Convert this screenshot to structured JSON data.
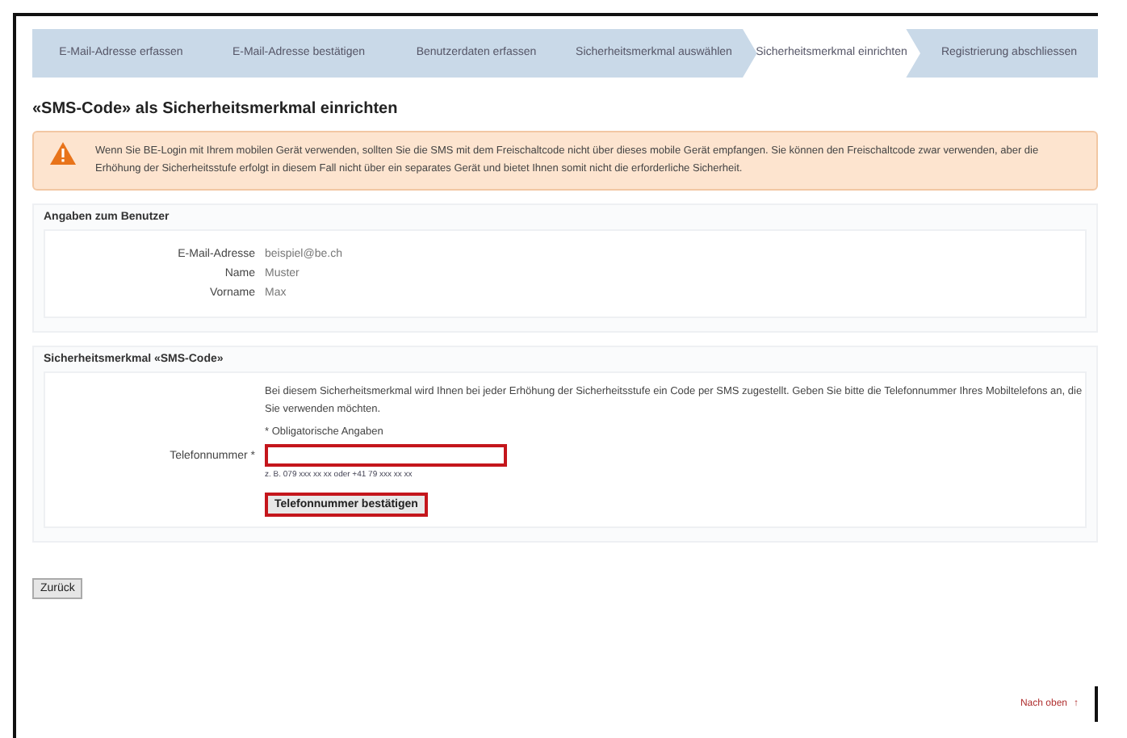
{
  "steps": [
    {
      "label": "E-Mail-Adresse erfassen",
      "selected": false
    },
    {
      "label": "E-Mail-Adresse bestätigen",
      "selected": false
    },
    {
      "label": "Benutzerdaten erfassen",
      "selected": false
    },
    {
      "label": "Sicherheitsmerkmal auswählen",
      "selected": false
    },
    {
      "label": "Sicherheitsmerkmal einrichten",
      "selected": true
    },
    {
      "label": "Registrierung abschliessen",
      "selected": false
    }
  ],
  "title": "«SMS-Code» als Sicherheitsmerkmal einrichten",
  "warning": "Wenn Sie BE-Login mit Ihrem mobilen Gerät verwenden, sollten Sie die SMS mit dem Freischaltcode nicht über dieses mobile Gerät empfangen. Sie können den Freischaltcode zwar verwenden, aber die Erhöhung der Sicherheitsstufe erfolgt in diesem Fall nicht über ein separates Gerät und bietet Ihnen somit nicht die erforderliche Sicherheit.",
  "user_section": {
    "legend": "Angaben zum Benutzer",
    "fields": [
      {
        "label": "E-Mail-Adresse",
        "value": "beispiel@be.ch"
      },
      {
        "label": "Name",
        "value": "Muster"
      },
      {
        "label": "Vorname",
        "value": "Max"
      }
    ]
  },
  "sms_section": {
    "legend": "Sicherheitsmerkmal «SMS-Code»",
    "intro": "Bei diesem Sicherheitsmerkmal wird Ihnen bei jeder Erhöhung der Sicherheitsstufe ein Code per SMS zugestellt. Geben Sie bitte die Telefonnummer Ihres Mobiltelefons an, die Sie verwenden möchten.",
    "required_note": "* Obligatorische Angaben",
    "phone_label": "Telefonnummer *",
    "phone_hint": "z. B. 079 xxx xx xx oder +41 79 xxx xx xx",
    "confirm_button": "Telefonnummer bestätigen"
  },
  "back_button": "Zurück",
  "top_link": "Nach oben",
  "top_link_icon": "↑"
}
